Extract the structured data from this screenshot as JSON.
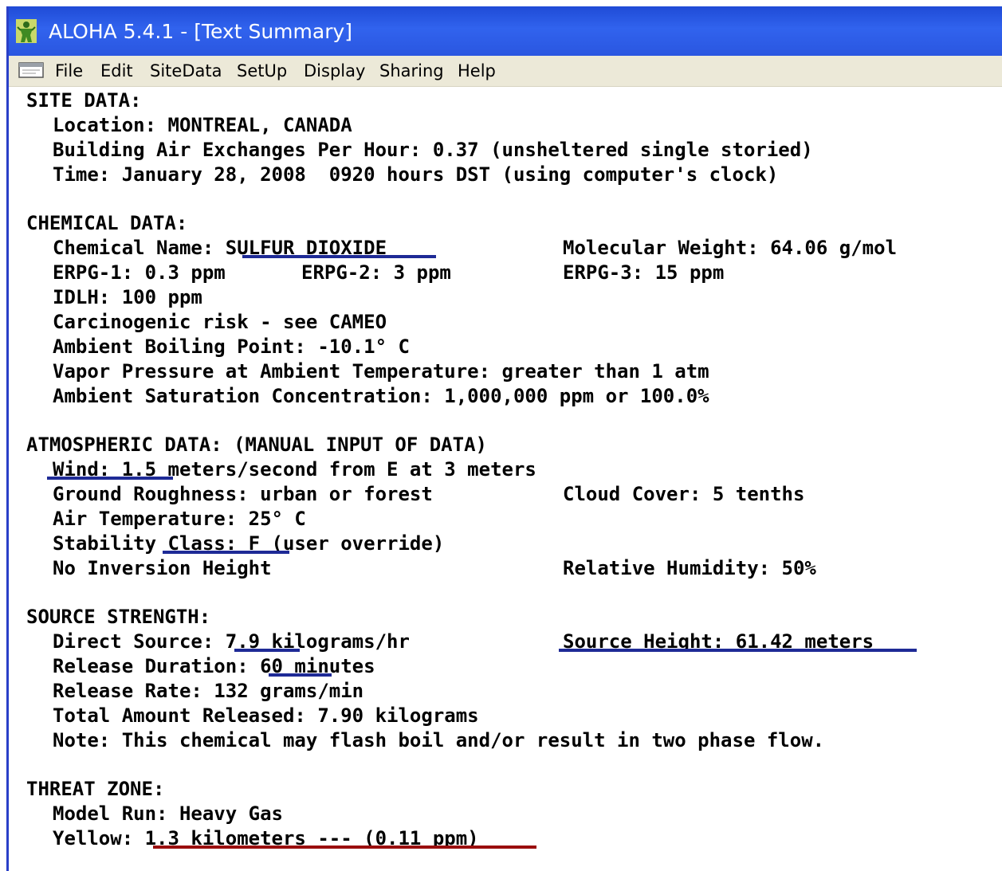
{
  "window": {
    "title": "ALOHA 5.4.1 - [Text Summary]",
    "app_icon": "aloha-figure-icon",
    "doc_icon": "text-document-icon"
  },
  "menu": [
    "File",
    "Edit",
    "SiteData",
    "SetUp",
    "Display",
    "Sharing",
    "Help"
  ],
  "site": {
    "header": "SITE DATA:",
    "location": "Location: MONTREAL, CANADA",
    "building": "Building Air Exchanges Per Hour: 0.37 (unsheltered single storied)",
    "time": "Time: January 28, 2008  0920 hours DST (using computer's clock)"
  },
  "chemical": {
    "header": "CHEMICAL DATA:",
    "name": "Chemical Name: SULFUR DIOXIDE",
    "mol_weight": "Molecular Weight: 64.06 g/mol",
    "erpg1": "ERPG-1: 0.3 ppm",
    "erpg2": "ERPG-2: 3 ppm",
    "erpg3": "ERPG-3: 15 ppm",
    "idlh": "IDLH: 100 ppm",
    "carcinogenic": "Carcinogenic risk - see CAMEO",
    "boiling_point": "Ambient Boiling Point: -10.1° C",
    "vapor_pressure": "Vapor Pressure at Ambient Temperature: greater than 1 atm",
    "saturation": "Ambient Saturation Concentration: 1,000,000 ppm or 100.0%"
  },
  "atmospheric": {
    "header": "ATMOSPHERIC DATA: (MANUAL INPUT OF DATA)",
    "wind": "Wind: 1.5 meters/second from E at 3 meters",
    "roughness": "Ground Roughness: urban or forest",
    "cloud_cover": "Cloud Cover: 5 tenths",
    "air_temp": "Air Temperature: 25° C",
    "stability": "Stability Class: F (user override)",
    "inversion": "No Inversion Height",
    "humidity": "Relative Humidity: 50%"
  },
  "source": {
    "header": "SOURCE STRENGTH:",
    "direct": "Direct Source: 7.9 kilograms/hr",
    "height": "Source Height: 61.42 meters",
    "duration": "Release Duration: 60 minutes",
    "rate": "Release Rate: 132 grams/min",
    "total": "Total Amount Released: 7.90 kilograms",
    "note": "Note: This chemical may flash boil and/or result in two phase flow."
  },
  "threat": {
    "header": "THREAT ZONE:",
    "model": "Model Run: Heavy Gas",
    "yellow": "Yellow: 1.3 kilometers --- (0.11 ppm)"
  },
  "colors": {
    "titlebar": "#2a56e0",
    "menubar": "#ece9d8",
    "highlight_blue": "#1e2a96",
    "highlight_red": "#9a0e0e"
  }
}
